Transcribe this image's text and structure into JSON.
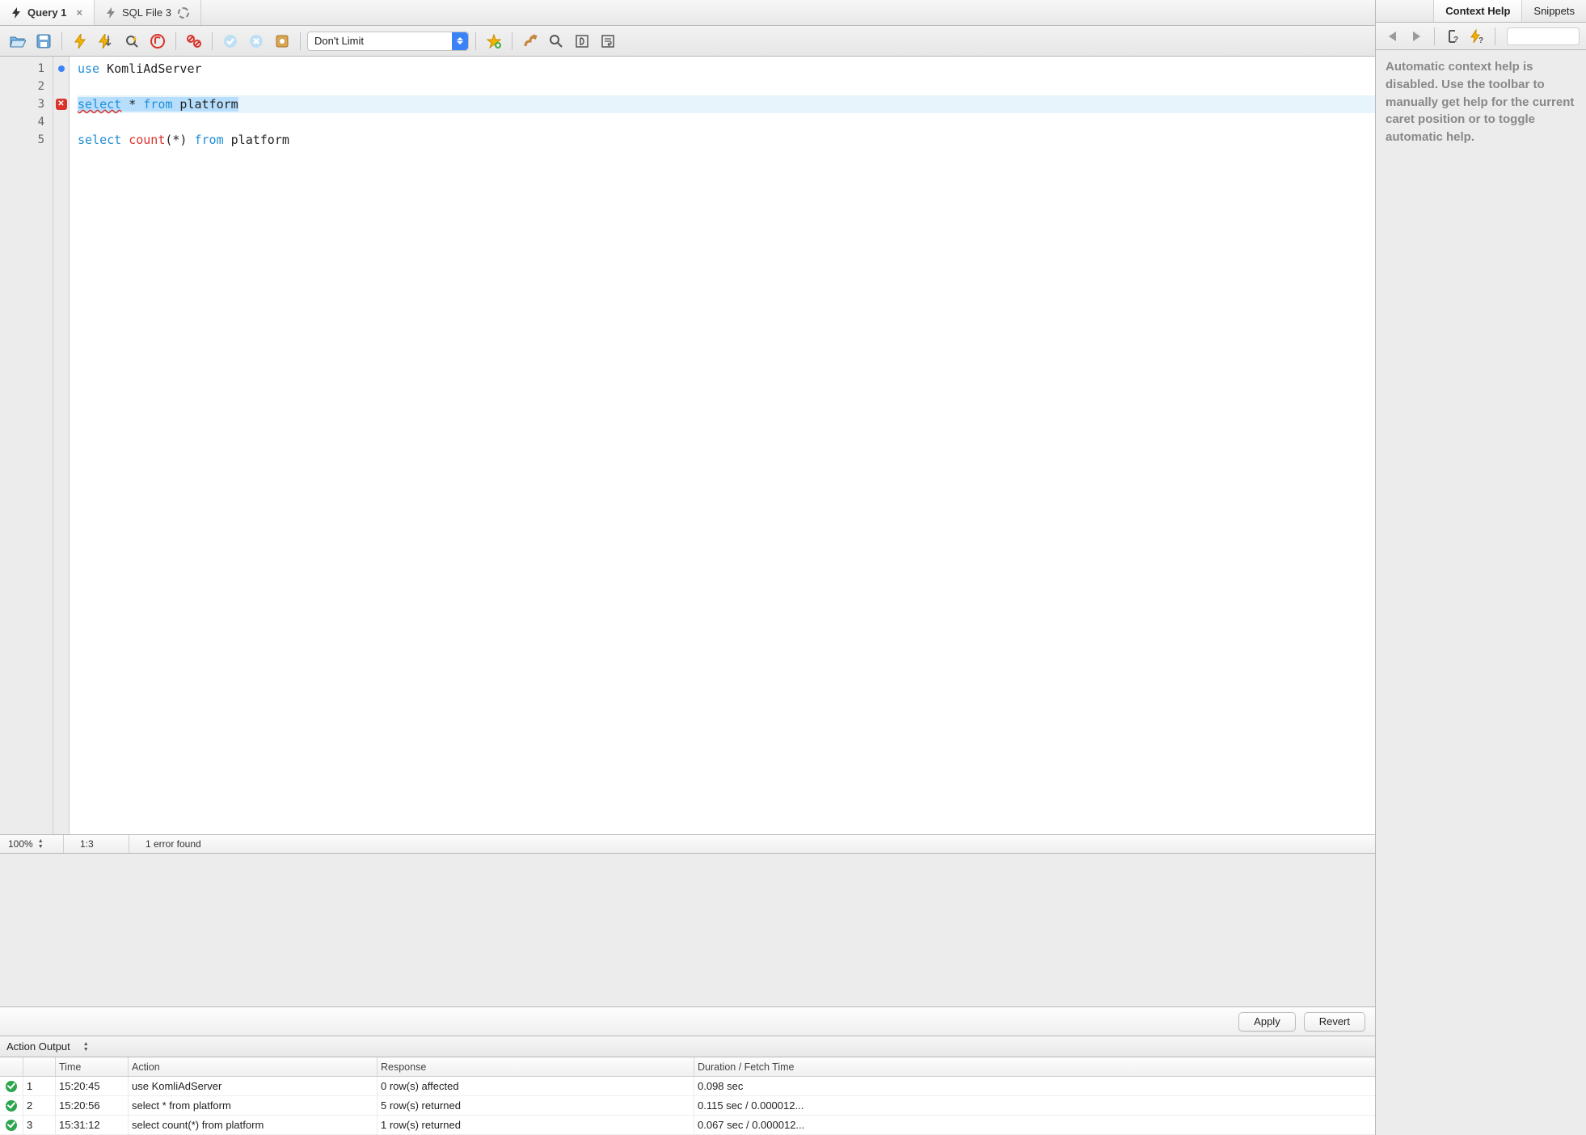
{
  "tabs": {
    "items": [
      {
        "label": "Query 1",
        "active": true,
        "loading": false,
        "closable": true
      },
      {
        "label": "SQL File 3",
        "active": false,
        "loading": true,
        "closable": false
      }
    ]
  },
  "toolbar": {
    "limit_select": "Don't Limit"
  },
  "editor": {
    "lines": [
      "1",
      "2",
      "3",
      "4",
      "5"
    ],
    "markers": {
      "1": "dot",
      "3": "error"
    },
    "code": {
      "l1_kw": "use",
      "l1_ident": " KomliAdServer",
      "l3_kw1": "select",
      "l3_star": " * ",
      "l3_kw2": "from",
      "l3_ident": " platform",
      "l5_kw1": "select",
      "l5_sp1": " ",
      "l5_fn": "count",
      "l5_args": "(*) ",
      "l5_kw2": "from",
      "l5_ident": " platform"
    },
    "status": {
      "zoom": "100%",
      "pos": "1:3",
      "message": "1 error found"
    }
  },
  "applybar": {
    "apply": "Apply",
    "revert": "Revert"
  },
  "output": {
    "selector": "Action Output",
    "headers": {
      "time": "Time",
      "action": "Action",
      "response": "Response",
      "duration": "Duration / Fetch Time"
    },
    "rows": [
      {
        "idx": "1",
        "time": "15:20:45",
        "action": "use KomliAdServer",
        "response": "0 row(s) affected",
        "duration": "0.098 sec"
      },
      {
        "idx": "2",
        "time": "15:20:56",
        "action": "select * from platform",
        "response": "5 row(s) returned",
        "duration": "0.115 sec / 0.000012..."
      },
      {
        "idx": "3",
        "time": "15:31:12",
        "action": "select count(*) from platform",
        "response": "1 row(s) returned",
        "duration": "0.067 sec / 0.000012..."
      }
    ]
  },
  "right": {
    "tabs": {
      "help": "Context Help",
      "snippets": "Snippets"
    },
    "body": "Automatic context help is disabled. Use the toolbar to manually get help for the current caret position or to toggle automatic help."
  }
}
